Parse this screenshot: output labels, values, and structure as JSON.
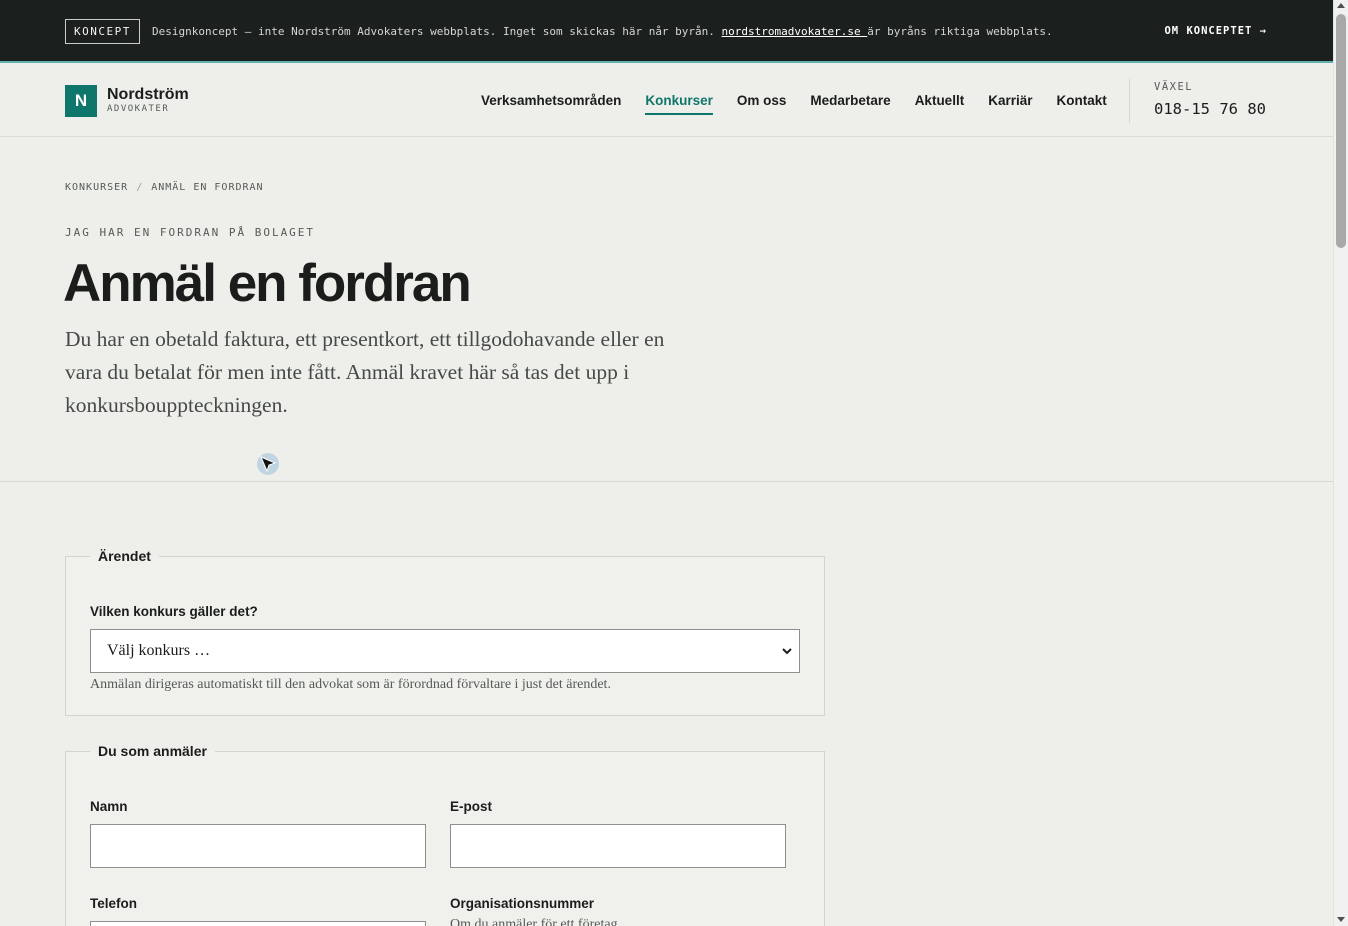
{
  "topbar": {
    "badge": "KONCEPT",
    "text_before": "Designkoncept – inte Nordström Advokaters webbplats. Inget som skickas här når byrån. ",
    "link": "nordstromadvokater.se ",
    "text_after": "är byråns riktiga webbplats.",
    "om_link": "OM KONCEPTET →"
  },
  "header": {
    "logo_letter": "N",
    "logo_name": "Nordström",
    "logo_sub": "ADVOKATER",
    "nav": [
      "Verksamhetsområden",
      "Konkurser",
      "Om oss",
      "Medarbetare",
      "Aktuellt",
      "Karriär",
      "Kontakt"
    ],
    "nav_active": "Konkurser",
    "vaxel_label": "VÄXEL",
    "vaxel_number": "018-15 76 80"
  },
  "hero": {
    "breadcrumb": [
      "KONKURSER",
      "/",
      "ANMÄL EN FORDRAN"
    ],
    "eyebrow": "JAG HAR EN FORDRAN PÅ BOLAGET",
    "title": "Anmäl en fordran",
    "lead": "Du har en obetald faktura, ett presentkort, ett tillgodohavande eller en vara du betalat för men inte fått. Anmäl kravet här så tas det upp i konkursbouppteckningen."
  },
  "form": {
    "arendet": {
      "legend": "Ärendet",
      "konkurs_label": "Vilken konkurs gäller det?",
      "konkurs_selected": "Välj konkurs …",
      "konkurs_help": "Anmälan dirigeras automatiskt till den advokat som är förordnad förvaltare i just det ärendet."
    },
    "anmalare": {
      "legend": "Du som anmäler",
      "namn_label": "Namn",
      "epost_label": "E-post",
      "telefon_label": "Telefon",
      "orgnr_label": "Organisationsnummer",
      "orgnr_help": "Om du anmäler för ett företag"
    }
  },
  "colors": {
    "accent": "#0f766b",
    "topbar_bg": "#1b1f1d",
    "page_bg": "#eeefea"
  }
}
